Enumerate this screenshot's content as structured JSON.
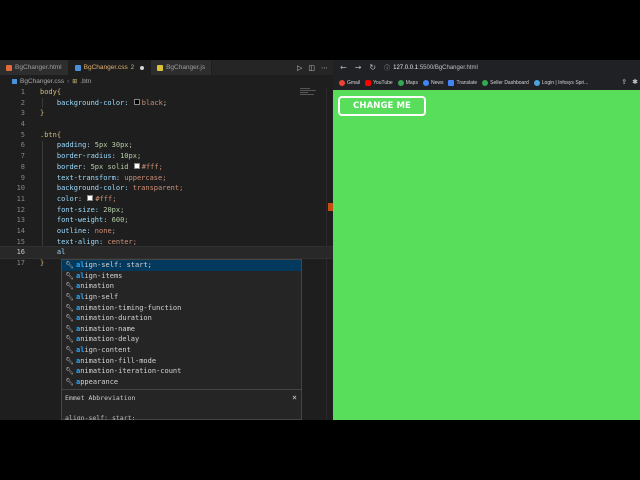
{
  "editor": {
    "tabs": [
      {
        "label": "BgChanger.html",
        "icon": "html-file-icon"
      },
      {
        "label": "BgChanger.css",
        "count": "2",
        "icon": "css-file-icon"
      },
      {
        "label": "BgChanger.js",
        "icon": "js-file-icon"
      }
    ],
    "breadcrumb": {
      "file": "BgChanger.css",
      "symbol": ".btn"
    },
    "line_numbers": [
      "1",
      "2",
      "3",
      "4",
      "5",
      "6",
      "7",
      "8",
      "9",
      "10",
      "11",
      "12",
      "13",
      "14",
      "15",
      "16",
      "17"
    ],
    "code": {
      "l1_sel": "body{",
      "l2_prop": "background-color:",
      "l2_val": "black",
      "l3": "}",
      "l5_sel": ".btn{",
      "l6_prop": "padding:",
      "l6_val": "5px 30px;",
      "l7_prop": "border-radius:",
      "l7_val": "10px;",
      "l8_prop": "border:",
      "l8_val1": "5px solid",
      "l8_val2": "#fff;",
      "l9_prop": "text-transform:",
      "l9_val": "uppercase;",
      "l10_prop": "background-color:",
      "l10_val": "transparent;",
      "l11_prop": "color:",
      "l11_val": "#fff;",
      "l12_prop": "font-size:",
      "l12_val": "20px;",
      "l13_prop": "font-weight:",
      "l13_val": "600;",
      "l14_prop": "outline:",
      "l14_val": "none;",
      "l15_prop": "text-align:",
      "l15_val": "center;",
      "l16_typed": "al",
      "l17": "}"
    },
    "suggestions": [
      {
        "match": "al",
        "rest": "ign-self: start;"
      },
      {
        "match": "al",
        "rest": "ign-items"
      },
      {
        "match": "a",
        "rest": "nimation"
      },
      {
        "match": "al",
        "rest": "ign-self"
      },
      {
        "match": "a",
        "rest": "nimation-timing-function"
      },
      {
        "match": "a",
        "rest": "nimation-duration"
      },
      {
        "match": "a",
        "rest": "nimation-name"
      },
      {
        "match": "a",
        "rest": "nimation-delay"
      },
      {
        "match": "al",
        "rest": "ign-content"
      },
      {
        "match": "a",
        "rest": "nimation-fill-mode"
      },
      {
        "match": "a",
        "rest": "nimation-iteration-count"
      },
      {
        "match": "a",
        "rest": "ppearance"
      }
    ],
    "detail": {
      "title": "Emmet Abbreviation",
      "close": "×",
      "body": "align-self: start;"
    }
  },
  "browser": {
    "url_host": "127.0.0.1",
    "url_path": ":5500/BgChanger.html",
    "bookmarks": [
      {
        "label": "Gmail",
        "color": "#ea4335"
      },
      {
        "label": "YouTube",
        "color": "#ff0000"
      },
      {
        "label": "Maps",
        "color": "#34a853"
      },
      {
        "label": "News",
        "color": "#4285f4"
      },
      {
        "label": "Translate",
        "color": "#4285f4"
      },
      {
        "label": "Seller Dashboard",
        "color": "#34a853"
      },
      {
        "label": "Login | Infosys Spri...",
        "color": "#4aa3df"
      }
    ],
    "page": {
      "button_label": "CHANGE ME",
      "background": "#58de5b"
    }
  }
}
